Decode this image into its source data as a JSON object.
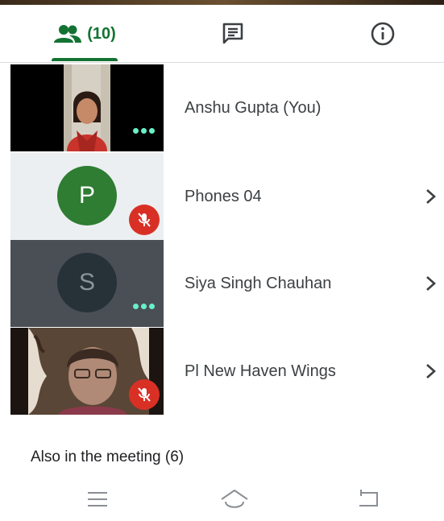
{
  "tabs": {
    "people_count": "(10)",
    "people_icon": "people-icon",
    "chat_icon": "chat-icon",
    "info_icon": "info-icon"
  },
  "participants": [
    {
      "name": "Anshu Gupta (You)",
      "tile": "video",
      "status": "more-options",
      "chevron": false
    },
    {
      "name": "Phones 04",
      "tile": "avatar",
      "avatar_letter": "P",
      "avatar_color": "#2e7d32",
      "status": "muted",
      "chevron": true
    },
    {
      "name": "Siya Singh Chauhan",
      "tile": "avatar",
      "avatar_letter": "S",
      "avatar_color": "#263238",
      "status": "more-options",
      "chevron": true
    },
    {
      "name": "Pl New Haven Wings",
      "tile": "video",
      "status": "muted",
      "chevron": true
    }
  ],
  "also_in_meeting": "Also in the meeting (6)",
  "colors": {
    "accent": "#137333",
    "mute": "#d93025",
    "speaking": "#69f0c8"
  },
  "navbar": {
    "icons": [
      "menu-icon",
      "home-icon",
      "back-icon"
    ]
  }
}
